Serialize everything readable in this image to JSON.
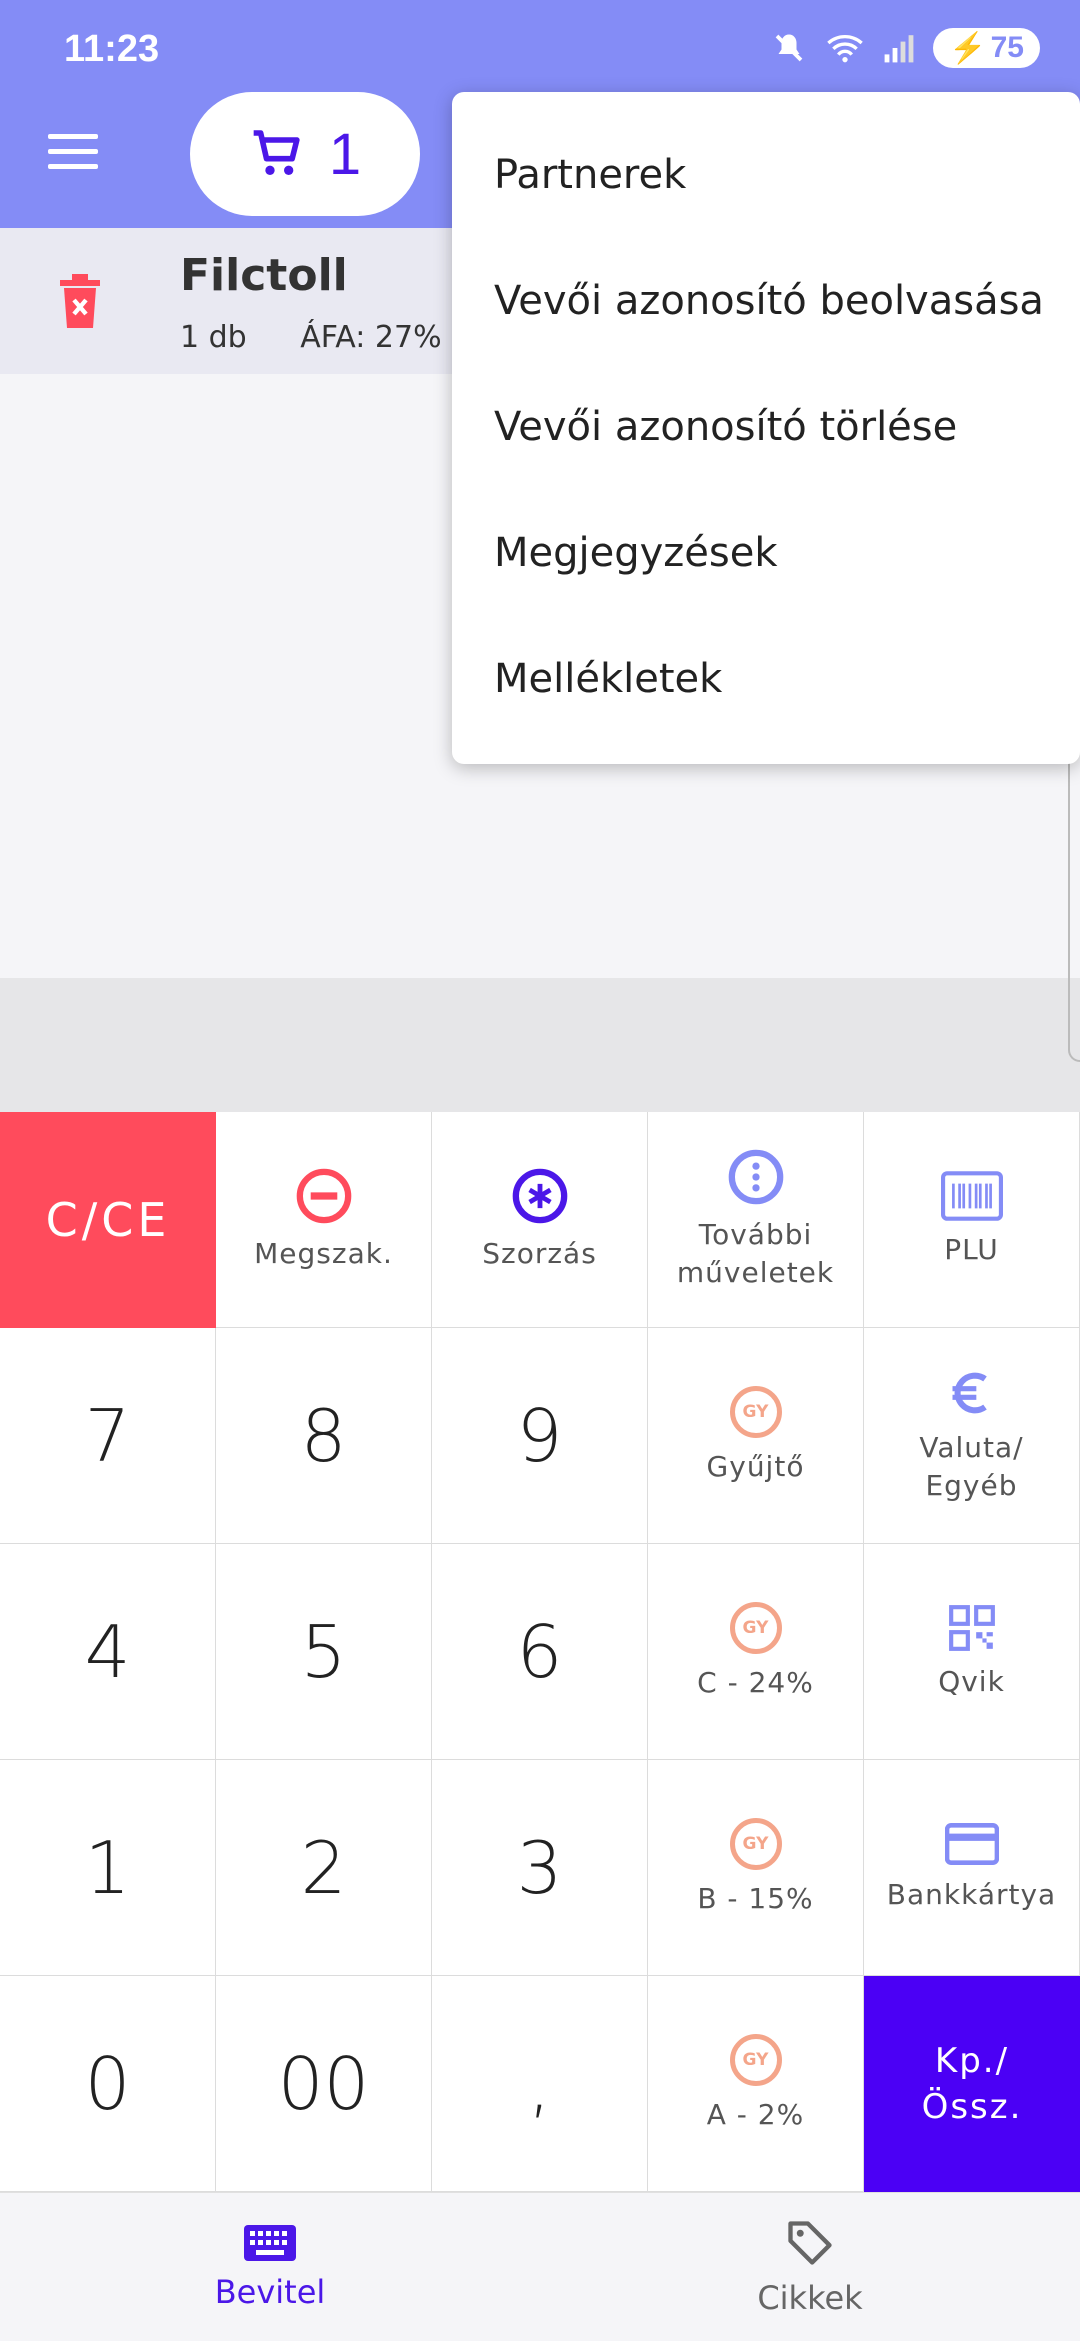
{
  "status_bar": {
    "time": "11:23",
    "battery": "75"
  },
  "cart": {
    "count": "1"
  },
  "item": {
    "name": "Filctoll",
    "quantity": "1 db",
    "vat": "ÁFA: 27%"
  },
  "dropdown": {
    "items": [
      "Partnerek",
      "Vevői azonosító beolvasása",
      "Vevői azonosító törlése",
      "Megjegyzések",
      "Mellékletek"
    ]
  },
  "keypad": {
    "ce": "C/CE",
    "megszak": "Megszak.",
    "szorzas": "Szorzás",
    "tovabbi_1": "További",
    "tovabbi_2": "műveletek",
    "plu": "PLU",
    "gyujto": "Gyűjtő",
    "valuta_1": "Valuta/",
    "valuta_2": "Egyéb",
    "c24": "C - 24%",
    "qvik": "Qvik",
    "b15": "B - 15%",
    "bankkartya": "Bankkártya",
    "a2": "A - 2%",
    "pay_1": "Kp./",
    "pay_2": "Össz.",
    "gy_badge": "GY",
    "digits": {
      "k7": "7",
      "k8": "8",
      "k9": "9",
      "k4": "4",
      "k5": "5",
      "k6": "6",
      "k1": "1",
      "k2": "2",
      "k3": "3",
      "k0": "0",
      "k00": "00",
      "comma": ","
    }
  },
  "nav": {
    "bevitel": "Bevitel",
    "cikkek": "Cikkek"
  },
  "colors": {
    "primary": "#848cf6",
    "accent": "#4b17e8",
    "danger": "#ff4b5c",
    "pay": "#4b00f5",
    "gy": "#f4a58a"
  }
}
